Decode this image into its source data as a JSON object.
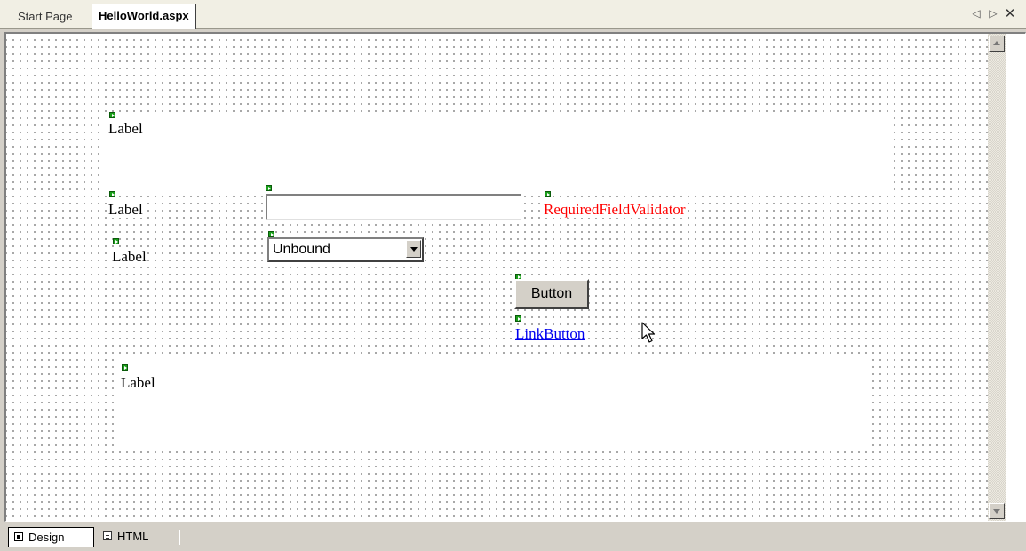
{
  "tabs": {
    "start_page": "Start Page",
    "active_document": "HelloWorld.aspx",
    "nav_left_icon": "scroll-tabs-left-icon",
    "nav_right_icon": "scroll-tabs-right-icon",
    "close_icon": "close-icon"
  },
  "designer": {
    "labels": [
      "Label",
      "Label",
      "Label",
      "Label"
    ],
    "validator_text": "RequiredFieldValidator",
    "validator_color": "#ff0000",
    "textbox_value": "",
    "dropdown_selected": "Unbound",
    "button_text": "Button",
    "linkbutton_text": "LinkButton",
    "linkbutton_color": "#0000ee",
    "control_handle_color": "#1a9e1a"
  },
  "views": {
    "design": "Design",
    "html": "HTML"
  }
}
